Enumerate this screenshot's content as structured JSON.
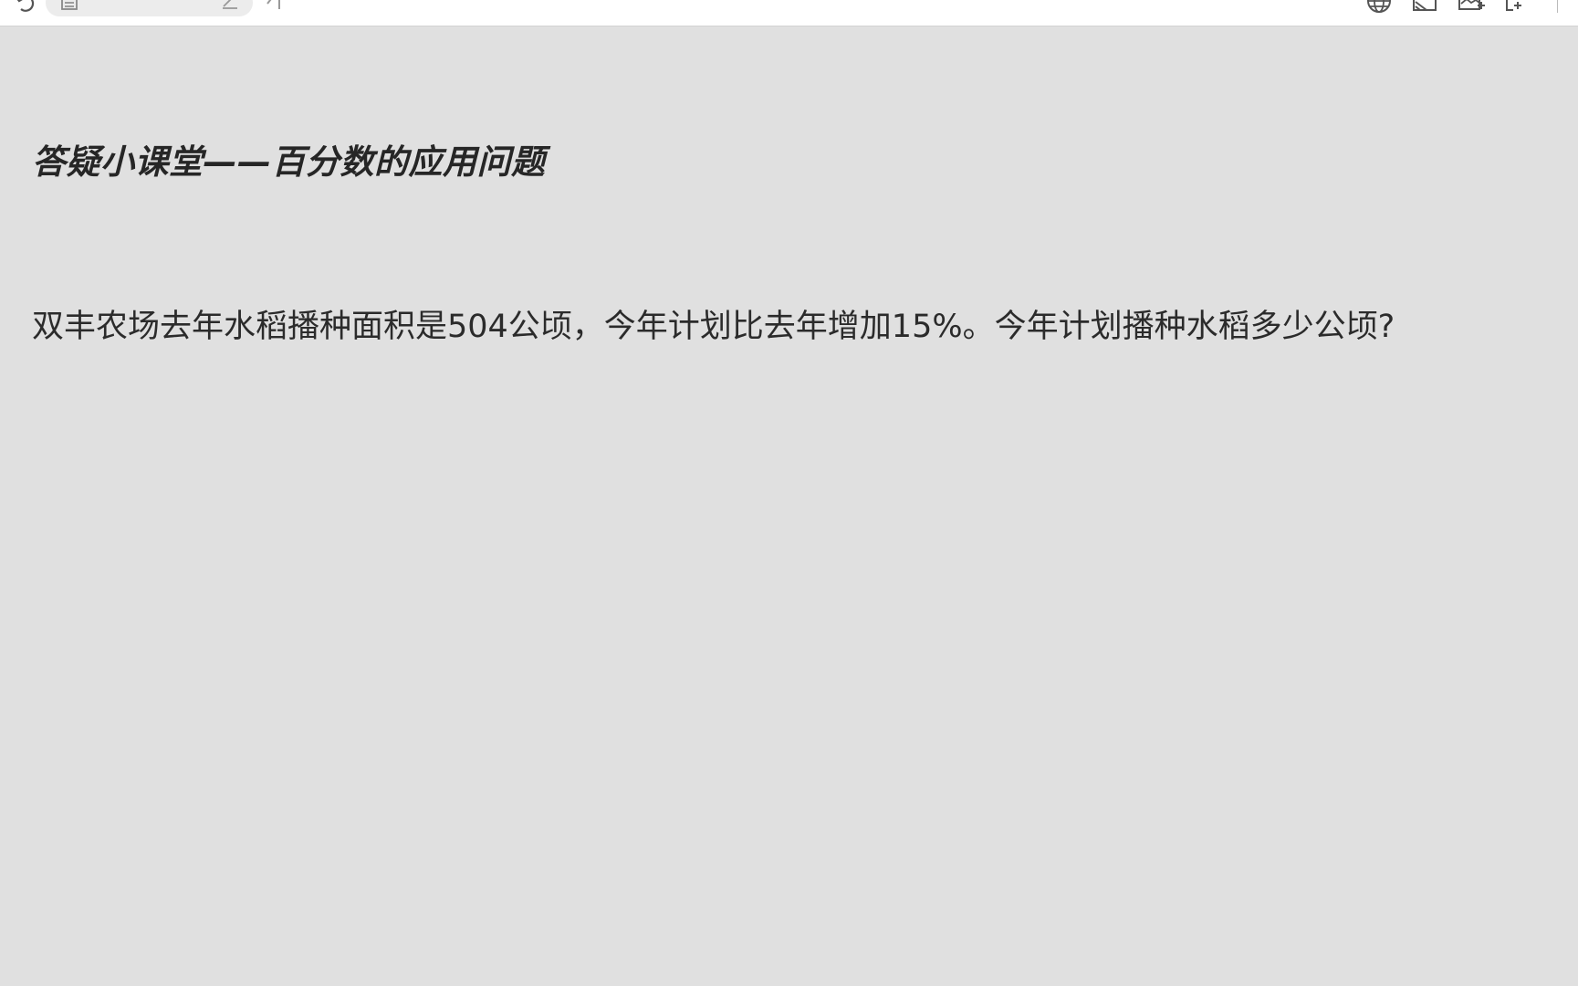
{
  "toolbar": {
    "icons": {
      "undo": "undo-icon",
      "document": "document-icon",
      "edit": "edit-icon",
      "back": "back-icon",
      "globe": "globe-icon",
      "cast": "cast-icon",
      "add_image": "add-image-icon",
      "fullscreen": "fullscreen-icon"
    }
  },
  "document": {
    "title": "答疑小课堂——百分数的应用问题",
    "question": "双丰农场去年水稻播种面积是504公顷，今年计划比去年增加15%。今年计划播种水稻多少公顷?"
  },
  "colors": {
    "background": "#e0e0e0",
    "toolbar": "#ffffff",
    "text": "#2b2b2b"
  }
}
